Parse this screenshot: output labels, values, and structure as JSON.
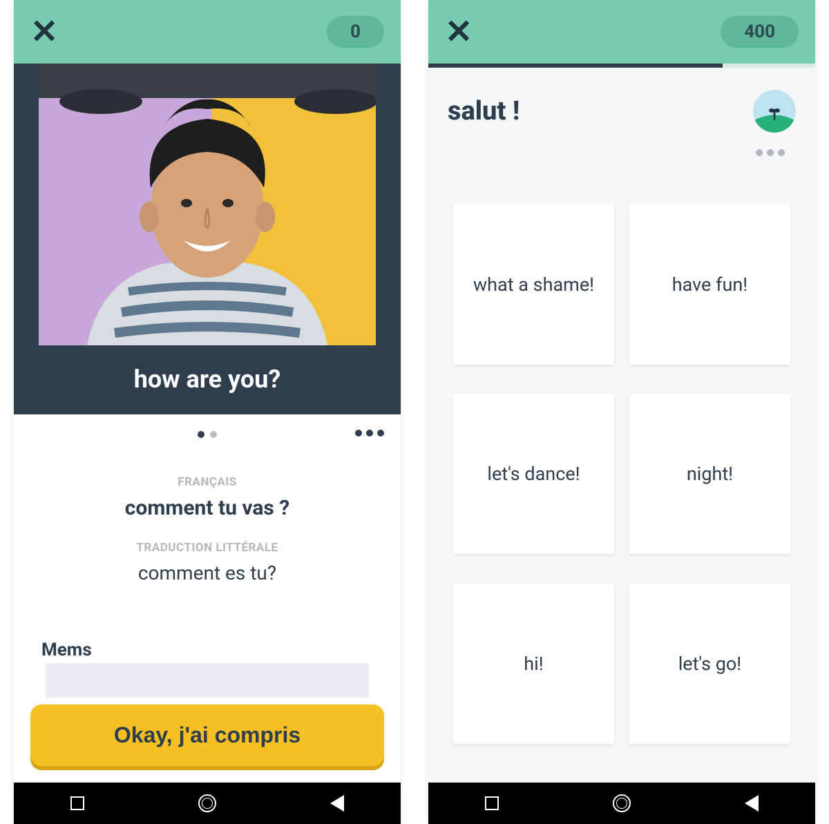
{
  "left": {
    "score": "0",
    "caption": "how are you?",
    "lang_label": "FRANÇAIS",
    "phrase": "comment tu vas ?",
    "literal_label": "TRADUCTION LITTÉRALE",
    "literal": "comment es tu?",
    "mems_label": "Mems",
    "cta": "Okay, j'ai compris"
  },
  "right": {
    "score": "400",
    "question": "salut !",
    "answers": [
      "what a shame!",
      "have fun!",
      "let's dance!",
      "night!",
      "hi!",
      "let's go!"
    ]
  }
}
